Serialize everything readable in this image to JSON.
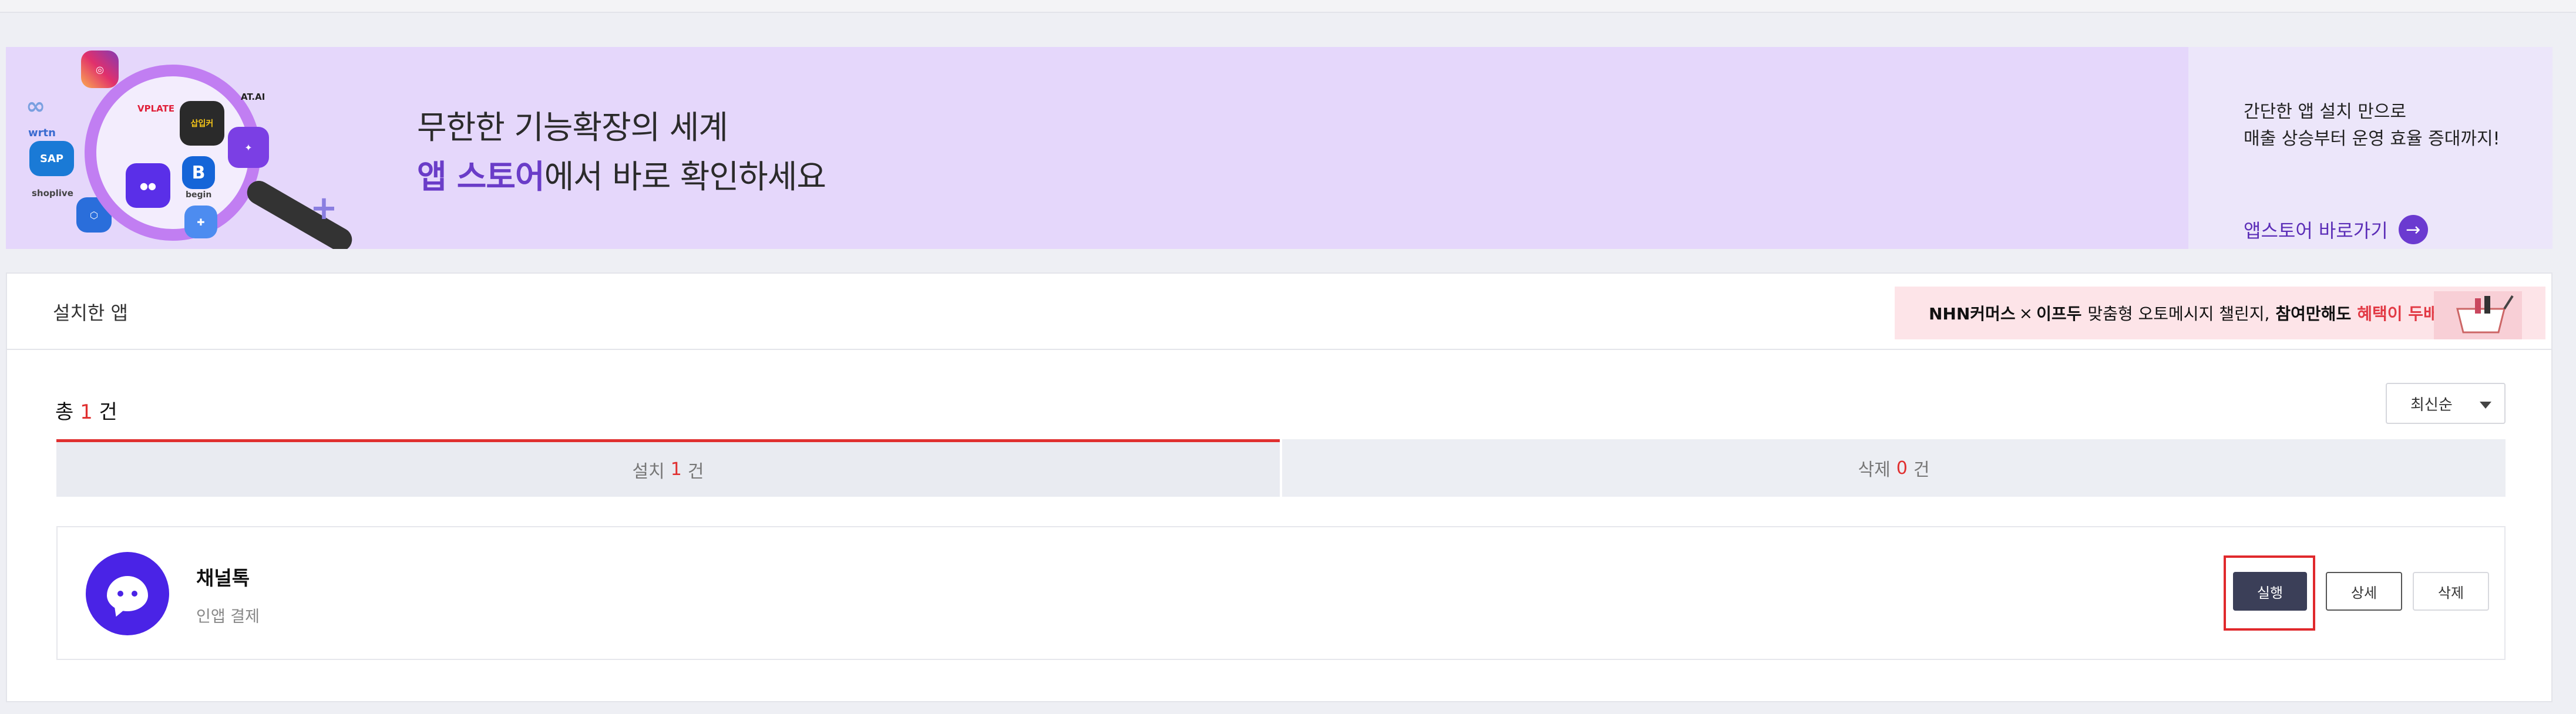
{
  "banner": {
    "headline_line1": "무한한 기능확장의 세계",
    "headline_accent": "앱 스토어",
    "headline_line2_rest": "에서 바로 확인하세요",
    "side_line1": "간단한 앱 설치 만으로",
    "side_line2": "매출 상승부터 운영 효율 증대까지!",
    "store_link_label": "앱스토어 바로가기",
    "collage_labels": {
      "wrtn": "wrtn",
      "vplate": "VPLATE",
      "sap": "SAP",
      "shoplive": "shoplive",
      "begin": "begin",
      "ai": "AT.AI",
      "x": "삽입커"
    }
  },
  "installed": {
    "title": "설치한 앱",
    "promo": {
      "brand": "NHN커머스",
      "cross": "×",
      "partner": "이프두",
      "middle": "맞춤형 오토메시지 챌린지,",
      "bold": "참여만해도",
      "highlight": "혜택이 두배!"
    },
    "total_prefix": "총",
    "total_count": "1",
    "total_suffix": "건",
    "sort_value": "최신순",
    "tabs": [
      {
        "label": "설치",
        "count": "1",
        "suffix": "건"
      },
      {
        "label": "삭제",
        "count": "0",
        "suffix": "건"
      }
    ],
    "apps": [
      {
        "name": "채널톡",
        "category": "인앱 결제",
        "run_label": "실행",
        "detail_label": "상세",
        "delete_label": "삭제"
      }
    ]
  },
  "colors": {
    "accent_red": "#e02f2f",
    "purple": "#6a3cc8",
    "run_button": "#3b3f58",
    "channel_logo": "#4a23e6"
  }
}
